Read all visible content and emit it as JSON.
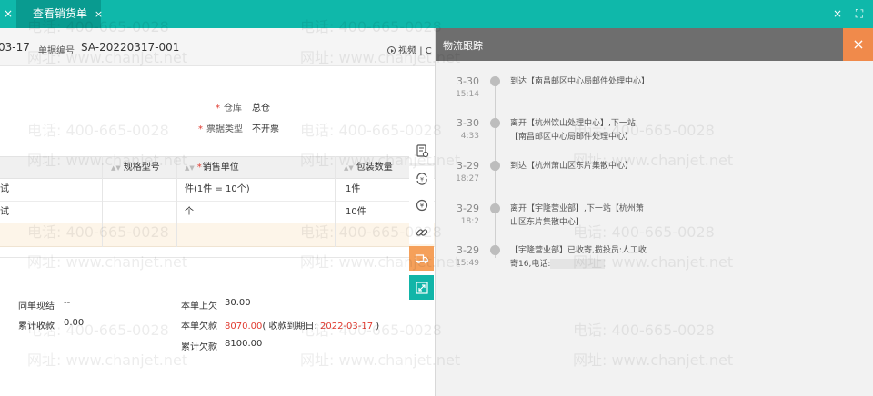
{
  "tabs": {
    "prev_close": "×",
    "active_label": "查看销货单",
    "active_close": "×"
  },
  "window": {
    "close_label": "×",
    "fullscreen_label": "⛶"
  },
  "header": {
    "date": "03-17",
    "doc_no_label": "单据编号",
    "doc_no": "SA-20220317-001",
    "video_label": "视频",
    "video_more": "| C"
  },
  "form": {
    "warehouse_label": "仓库",
    "warehouse_value": "总仓",
    "invoice_type_label": "票据类型",
    "invoice_type_value": "不开票",
    "required_mark": "*"
  },
  "table": {
    "headers": [
      "规格型号",
      "销售单位",
      "包装数量"
    ],
    "rows": [
      {
        "name": "试",
        "unit": "件(1件 = 10个)",
        "pack": "1件"
      },
      {
        "name": "试",
        "unit": "个",
        "pack": "10件"
      }
    ]
  },
  "summary": {
    "same_cash_label": "同单现结",
    "same_cash_value": "--",
    "accum_recv_label": "累计收款",
    "accum_recv_value": "0.00",
    "prev_debt_label": "本单上欠",
    "prev_debt_value": "30.00",
    "cur_debt_label": "本单欠款",
    "cur_debt_value": "8070.00",
    "due_prefix": "( 收款到期日: ",
    "due_date": "2022-03-17",
    "due_suffix": " )",
    "total_debt_label": "累计欠款",
    "total_debt_value": "8100.00"
  },
  "logistics": {
    "title": "物流跟踪",
    "close_label": "×",
    "events": [
      {
        "date": "3-30",
        "time": "15:14",
        "text": "到达【南昌邮区中心局邮件处理中心】"
      },
      {
        "date": "3-30",
        "time": "4:33",
        "text": "离开【杭州饮山处理中心】,下一站【南昌邮区中心局邮件处理中心】"
      },
      {
        "date": "3-29",
        "time": "18:27",
        "text": "到达【杭州萧山区东片集散中心】"
      },
      {
        "date": "3-29",
        "time": "18:2",
        "text": "离开【宇隆营业部】,下一站【杭州萧山区东片集散中心】"
      },
      {
        "date": "3-29",
        "time": "15:49",
        "text": "【宇隆营业部】已收寄,揽投员:人工收寄16,电话:"
      }
    ]
  },
  "watermark": {
    "phone": "电话: 400-665-0028",
    "site": "网址: www.chanjet.net"
  },
  "colors": {
    "brand_teal": "#0fb8aa",
    "accent_orange": "#f08a4b",
    "alert_red": "#e03a2f"
  },
  "icons": [
    "doc-check-icon",
    "refresh-money-icon",
    "currency-circle-icon",
    "link-icon",
    "truck-icon",
    "expand-icon"
  ]
}
